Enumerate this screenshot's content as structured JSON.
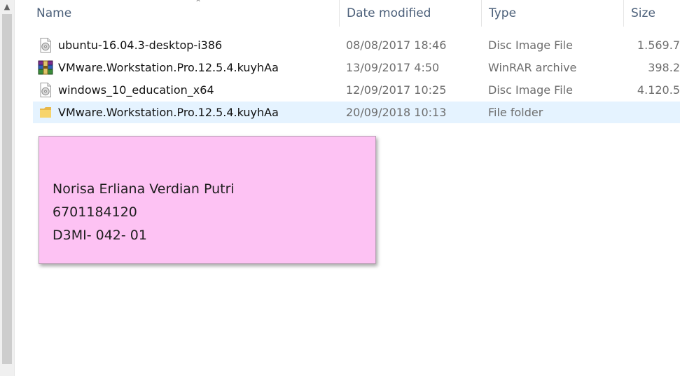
{
  "columns": {
    "name": "Name",
    "date_modified": "Date modified",
    "type": "Type",
    "size": "Size"
  },
  "files": [
    {
      "icon": "disc-image-icon",
      "name": "ubuntu-16.04.3-desktop-i386",
      "date": "08/08/2017 18:46",
      "type": "Disc Image File",
      "size": "1.569.7"
    },
    {
      "icon": "winrar-archive-icon",
      "name": "VMware.Workstation.Pro.12.5.4.kuyhAa",
      "date": "13/09/2017 4:50",
      "type": "WinRAR archive",
      "size": "398.2"
    },
    {
      "icon": "disc-image-icon",
      "name": "windows_10_education_x64",
      "date": "12/09/2017 10:25",
      "type": "Disc Image File",
      "size": "4.120.5"
    },
    {
      "icon": "folder-icon",
      "name": "VMware.Workstation.Pro.12.5.4.kuyhAa",
      "date": "20/09/2018 10:13",
      "type": "File folder",
      "size": ""
    }
  ],
  "note": {
    "line1": "Norisa Erliana Verdian Putri",
    "line2": "6701184120",
    "line3": "D3MI- 042- 01"
  },
  "colors": {
    "selected_row": "#e5f3ff",
    "note_background": "#fdc2f3",
    "header_text": "#4c607a"
  }
}
